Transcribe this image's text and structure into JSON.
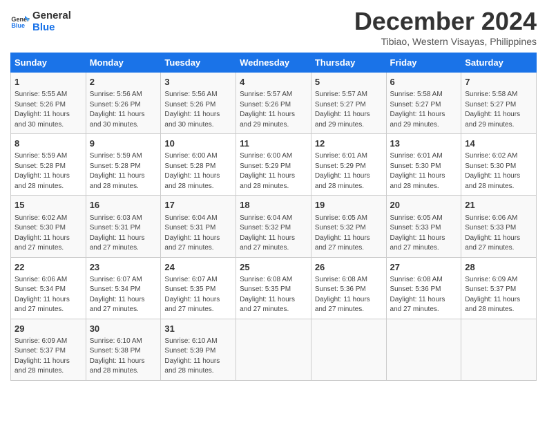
{
  "logo": {
    "line1": "General",
    "line2": "Blue"
  },
  "title": "December 2024",
  "subtitle": "Tibiao, Western Visayas, Philippines",
  "days_of_week": [
    "Sunday",
    "Monday",
    "Tuesday",
    "Wednesday",
    "Thursday",
    "Friday",
    "Saturday"
  ],
  "weeks": [
    [
      {
        "day": "1",
        "info": "Sunrise: 5:55 AM\nSunset: 5:26 PM\nDaylight: 11 hours\nand 30 minutes."
      },
      {
        "day": "2",
        "info": "Sunrise: 5:56 AM\nSunset: 5:26 PM\nDaylight: 11 hours\nand 30 minutes."
      },
      {
        "day": "3",
        "info": "Sunrise: 5:56 AM\nSunset: 5:26 PM\nDaylight: 11 hours\nand 30 minutes."
      },
      {
        "day": "4",
        "info": "Sunrise: 5:57 AM\nSunset: 5:26 PM\nDaylight: 11 hours\nand 29 minutes."
      },
      {
        "day": "5",
        "info": "Sunrise: 5:57 AM\nSunset: 5:27 PM\nDaylight: 11 hours\nand 29 minutes."
      },
      {
        "day": "6",
        "info": "Sunrise: 5:58 AM\nSunset: 5:27 PM\nDaylight: 11 hours\nand 29 minutes."
      },
      {
        "day": "7",
        "info": "Sunrise: 5:58 AM\nSunset: 5:27 PM\nDaylight: 11 hours\nand 29 minutes."
      }
    ],
    [
      {
        "day": "8",
        "info": "Sunrise: 5:59 AM\nSunset: 5:28 PM\nDaylight: 11 hours\nand 28 minutes."
      },
      {
        "day": "9",
        "info": "Sunrise: 5:59 AM\nSunset: 5:28 PM\nDaylight: 11 hours\nand 28 minutes."
      },
      {
        "day": "10",
        "info": "Sunrise: 6:00 AM\nSunset: 5:28 PM\nDaylight: 11 hours\nand 28 minutes."
      },
      {
        "day": "11",
        "info": "Sunrise: 6:00 AM\nSunset: 5:29 PM\nDaylight: 11 hours\nand 28 minutes."
      },
      {
        "day": "12",
        "info": "Sunrise: 6:01 AM\nSunset: 5:29 PM\nDaylight: 11 hours\nand 28 minutes."
      },
      {
        "day": "13",
        "info": "Sunrise: 6:01 AM\nSunset: 5:30 PM\nDaylight: 11 hours\nand 28 minutes."
      },
      {
        "day": "14",
        "info": "Sunrise: 6:02 AM\nSunset: 5:30 PM\nDaylight: 11 hours\nand 28 minutes."
      }
    ],
    [
      {
        "day": "15",
        "info": "Sunrise: 6:02 AM\nSunset: 5:30 PM\nDaylight: 11 hours\nand 27 minutes."
      },
      {
        "day": "16",
        "info": "Sunrise: 6:03 AM\nSunset: 5:31 PM\nDaylight: 11 hours\nand 27 minutes."
      },
      {
        "day": "17",
        "info": "Sunrise: 6:04 AM\nSunset: 5:31 PM\nDaylight: 11 hours\nand 27 minutes."
      },
      {
        "day": "18",
        "info": "Sunrise: 6:04 AM\nSunset: 5:32 PM\nDaylight: 11 hours\nand 27 minutes."
      },
      {
        "day": "19",
        "info": "Sunrise: 6:05 AM\nSunset: 5:32 PM\nDaylight: 11 hours\nand 27 minutes."
      },
      {
        "day": "20",
        "info": "Sunrise: 6:05 AM\nSunset: 5:33 PM\nDaylight: 11 hours\nand 27 minutes."
      },
      {
        "day": "21",
        "info": "Sunrise: 6:06 AM\nSunset: 5:33 PM\nDaylight: 11 hours\nand 27 minutes."
      }
    ],
    [
      {
        "day": "22",
        "info": "Sunrise: 6:06 AM\nSunset: 5:34 PM\nDaylight: 11 hours\nand 27 minutes."
      },
      {
        "day": "23",
        "info": "Sunrise: 6:07 AM\nSunset: 5:34 PM\nDaylight: 11 hours\nand 27 minutes."
      },
      {
        "day": "24",
        "info": "Sunrise: 6:07 AM\nSunset: 5:35 PM\nDaylight: 11 hours\nand 27 minutes."
      },
      {
        "day": "25",
        "info": "Sunrise: 6:08 AM\nSunset: 5:35 PM\nDaylight: 11 hours\nand 27 minutes."
      },
      {
        "day": "26",
        "info": "Sunrise: 6:08 AM\nSunset: 5:36 PM\nDaylight: 11 hours\nand 27 minutes."
      },
      {
        "day": "27",
        "info": "Sunrise: 6:08 AM\nSunset: 5:36 PM\nDaylight: 11 hours\nand 27 minutes."
      },
      {
        "day": "28",
        "info": "Sunrise: 6:09 AM\nSunset: 5:37 PM\nDaylight: 11 hours\nand 28 minutes."
      }
    ],
    [
      {
        "day": "29",
        "info": "Sunrise: 6:09 AM\nSunset: 5:37 PM\nDaylight: 11 hours\nand 28 minutes."
      },
      {
        "day": "30",
        "info": "Sunrise: 6:10 AM\nSunset: 5:38 PM\nDaylight: 11 hours\nand 28 minutes."
      },
      {
        "day": "31",
        "info": "Sunrise: 6:10 AM\nSunset: 5:39 PM\nDaylight: 11 hours\nand 28 minutes."
      },
      {
        "day": "",
        "info": ""
      },
      {
        "day": "",
        "info": ""
      },
      {
        "day": "",
        "info": ""
      },
      {
        "day": "",
        "info": ""
      }
    ]
  ]
}
